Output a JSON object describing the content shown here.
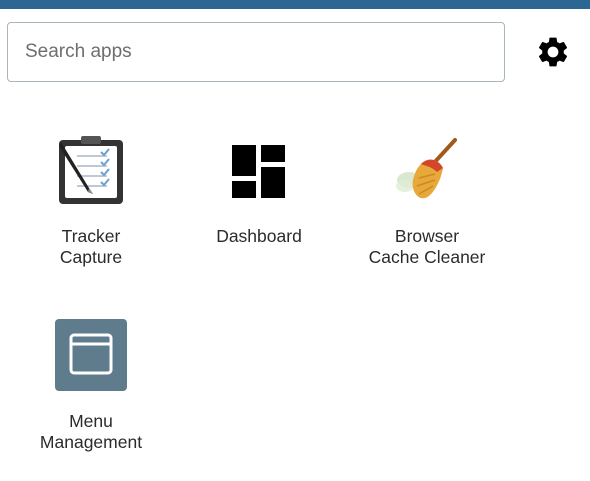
{
  "search": {
    "placeholder": "Search apps",
    "value": ""
  },
  "settings": {
    "icon": "gear-icon"
  },
  "apps": [
    {
      "label": "Tracker\nCapture",
      "icon": "clipboard-checklist-icon"
    },
    {
      "label": "Dashboard",
      "icon": "dashboard-grid-icon"
    },
    {
      "label": "Browser\nCache Cleaner",
      "icon": "broom-icon"
    },
    {
      "label": "Menu\nManagement",
      "icon": "window-icon"
    }
  ],
  "colors": {
    "topbar": "#2c6693",
    "menu_tile": "#5f7c8c"
  }
}
